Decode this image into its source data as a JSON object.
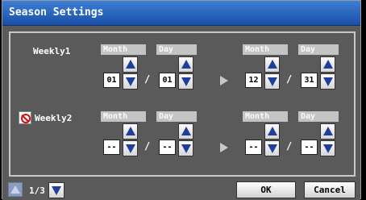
{
  "window": {
    "title": "Season Settings"
  },
  "rows": [
    {
      "label": "Weekly1",
      "start": {
        "month_header": "Month",
        "day_header": "Day",
        "month": "01",
        "day": "01"
      },
      "end": {
        "month_header": "Month",
        "day_header": "Day",
        "month": "12",
        "day": "31"
      }
    },
    {
      "label": "Weekly2",
      "disabled_icon": "prohibited-icon",
      "start": {
        "month_header": "Month",
        "day_header": "Day",
        "month": "--",
        "day": "--"
      },
      "end": {
        "month_header": "Month",
        "day_header": "Day",
        "month": "--",
        "day": "--"
      }
    }
  ],
  "separator": "/",
  "footer": {
    "page_indicator": "1/3",
    "ok_label": "OK",
    "cancel_label": "Cancel"
  },
  "colors": {
    "titlebar": "#2a63c0",
    "background": "#5a5a5a",
    "header_chip": "#c4c4c4",
    "arrow_blue": "#1f3f9a"
  }
}
